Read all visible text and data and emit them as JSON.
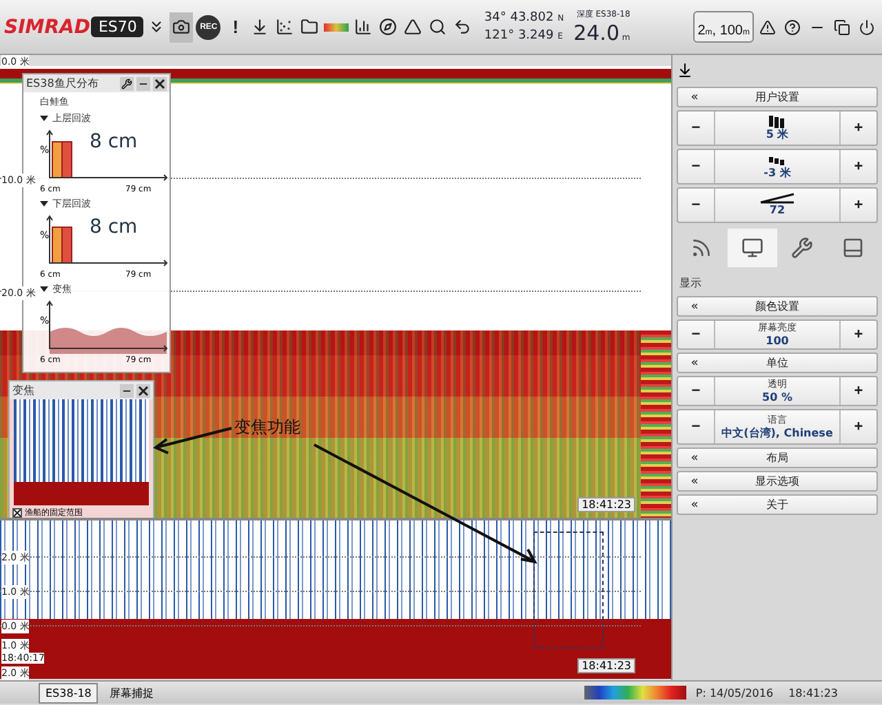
{
  "toolbar": {
    "brand": "SIMRAD",
    "model": "ES70",
    "record_label": "REC",
    "alert_label": "!",
    "latitude": "34° 43.802",
    "lat_hemisphere": "N",
    "longitude": "121° 3.249",
    "lon_hemisphere": "E",
    "depth_label": "深度 ES38-18",
    "depth": "24.0",
    "depth_unit": "m",
    "range_start": "2",
    "range_start_unit": "m",
    "range_separator": ",",
    "range_end": "100",
    "range_end_unit": "m"
  },
  "echogram": {
    "depth_labels": [
      "0.0 米",
      "10.0 米",
      "20.0 米"
    ],
    "timestamp": "18:41:23"
  },
  "size_panel": {
    "title": "ES38鱼尺分布",
    "species": "白鲑鱼",
    "sections": [
      {
        "kind": "bars",
        "title": "上层回波",
        "expanded": true,
        "value": "8 cm",
        "y_label": "%",
        "x_min": "6 cm",
        "x_max": "79 cm"
      },
      {
        "kind": "bars",
        "title": "下层回波",
        "expanded": true,
        "value": "8 cm",
        "y_label": "%",
        "x_min": "6 cm",
        "x_max": "79 cm"
      },
      {
        "kind": "wave",
        "title": "变焦",
        "expanded": true,
        "y_label": "%",
        "x_min": "6 cm",
        "x_max": "79 cm"
      }
    ]
  },
  "zoom_window": {
    "title": "变焦",
    "checkbox": {
      "label": "渔船的固定范围",
      "checked": true
    }
  },
  "annotation": {
    "text": "变焦功能"
  },
  "lower_echogram": {
    "depth_labels": [
      "2.0 米",
      "1.0 米",
      "0.0 米"
    ],
    "bottom_labels": [
      "1.0 米",
      "18:40:17",
      "2.0 米"
    ],
    "timestamp": "18:41:23"
  },
  "right_panel": {
    "user_settings": "用户设置",
    "top_controls": [
      {
        "value": "5 米"
      },
      {
        "value": "-3 米"
      },
      {
        "value": "72"
      }
    ],
    "tabs": [
      {
        "selected": false
      },
      {
        "selected": true
      },
      {
        "selected": false
      },
      {
        "selected": false
      }
    ],
    "section_title": "显示",
    "items": [
      {
        "kind": "nav",
        "label": "颜色设置"
      },
      {
        "kind": "stepper",
        "label": "屏幕亮度",
        "value": "100"
      },
      {
        "kind": "nav",
        "label": "单位"
      },
      {
        "kind": "stepper",
        "label": "透明",
        "value": "50 %"
      },
      {
        "kind": "stepper",
        "label": "语言",
        "value": "中文(台湾), Chinese"
      },
      {
        "kind": "nav",
        "label": "布局"
      },
      {
        "kind": "nav",
        "label": "显示选项"
      },
      {
        "kind": "nav",
        "label": "关于"
      }
    ],
    "nav_symbol": "«",
    "minus_symbol": "−",
    "plus_symbol": "+"
  },
  "status_bar": {
    "tabs": [
      {
        "label": "ES38-18",
        "selected": true
      },
      {
        "label": "屏幕捕捉",
        "selected": false
      }
    ],
    "position": "P: 14/05/2016",
    "time": "18:41:23"
  }
}
